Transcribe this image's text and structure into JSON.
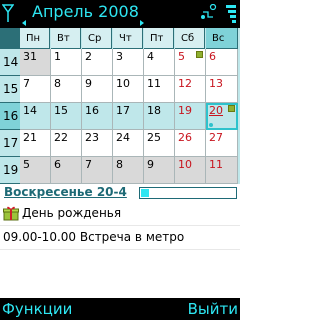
{
  "header": {
    "title": "Апрель 2008",
    "icons": [
      "signal-antenna-icon",
      "connectivity-icon",
      "battery-icon"
    ]
  },
  "calendar": {
    "weekdays": [
      "Пн",
      "Вт",
      "Ср",
      "Чт",
      "Пт",
      "Сб",
      "Вс"
    ],
    "selected_weekday_index": 6,
    "weeks": [
      {
        "number": "14",
        "days": [
          "31",
          "1",
          "2",
          "3",
          "4",
          "5",
          "6"
        ]
      },
      {
        "number": "15",
        "days": [
          "7",
          "8",
          "9",
          "10",
          "11",
          "12",
          "13"
        ]
      },
      {
        "number": "16",
        "days": [
          "14",
          "15",
          "16",
          "17",
          "18",
          "19",
          "20"
        ]
      },
      {
        "number": "17",
        "days": [
          "21",
          "22",
          "23",
          "24",
          "25",
          "26",
          "27"
        ]
      },
      {
        "number": "19",
        "days": [
          "5",
          "6",
          "7",
          "8",
          "9",
          "10",
          "11"
        ]
      }
    ],
    "selected_week_index": 2,
    "selected_date": "20",
    "colors": {
      "accent": "#2ee6f2",
      "weekend": "#c8141e",
      "header_bg": "#bfe7ea"
    }
  },
  "selected_day": {
    "title": "Воскресенье 20-4",
    "progress_fraction": 0.08
  },
  "entries": [
    {
      "icon": "gift-icon",
      "text": "День рожденья"
    },
    {
      "icon": "",
      "text": "09.00-10.00 Встреча в метро"
    }
  ],
  "softkeys": {
    "left": "Функции",
    "right": "Выйти"
  }
}
